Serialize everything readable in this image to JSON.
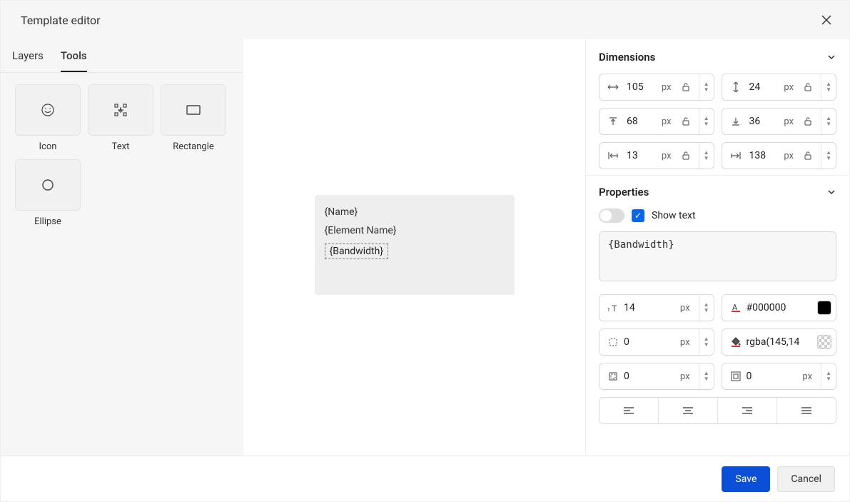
{
  "header": {
    "title": "Template editor"
  },
  "sidebar": {
    "tabs": {
      "layers": "Layers",
      "tools": "Tools"
    },
    "activeTab": "tools",
    "tools": [
      {
        "id": "icon",
        "label": "Icon"
      },
      {
        "id": "text",
        "label": "Text"
      },
      {
        "id": "rectangle",
        "label": "Rectangle"
      },
      {
        "id": "ellipse",
        "label": "Ellipse"
      }
    ]
  },
  "canvas": {
    "fields": {
      "name": "{Name}",
      "elementName": "{Element Name}",
      "bandwidth": "{Bandwidth}"
    }
  },
  "rightPanel": {
    "dimensions": {
      "title": "Dimensions",
      "width": {
        "value": "105",
        "unit": "px"
      },
      "height": {
        "value": "24",
        "unit": "px"
      },
      "top": {
        "value": "68",
        "unit": "px"
      },
      "bottom": {
        "value": "36",
        "unit": "px"
      },
      "left": {
        "value": "13",
        "unit": "px"
      },
      "right": {
        "value": "138",
        "unit": "px"
      }
    },
    "properties": {
      "title": "Properties",
      "showTextLabel": "Show text",
      "showText": true,
      "textValue": "{Bandwidth}",
      "fontSize": {
        "value": "14",
        "unit": "px"
      },
      "textColor": {
        "value": "#000000"
      },
      "borderRadius": {
        "value": "0",
        "unit": "px"
      },
      "bgColor": {
        "value": "rgba(145,14"
      },
      "borderWidth": {
        "value": "0",
        "unit": "px"
      },
      "padding": {
        "value": "0",
        "unit": "px"
      }
    }
  },
  "footer": {
    "save": "Save",
    "cancel": "Cancel"
  }
}
